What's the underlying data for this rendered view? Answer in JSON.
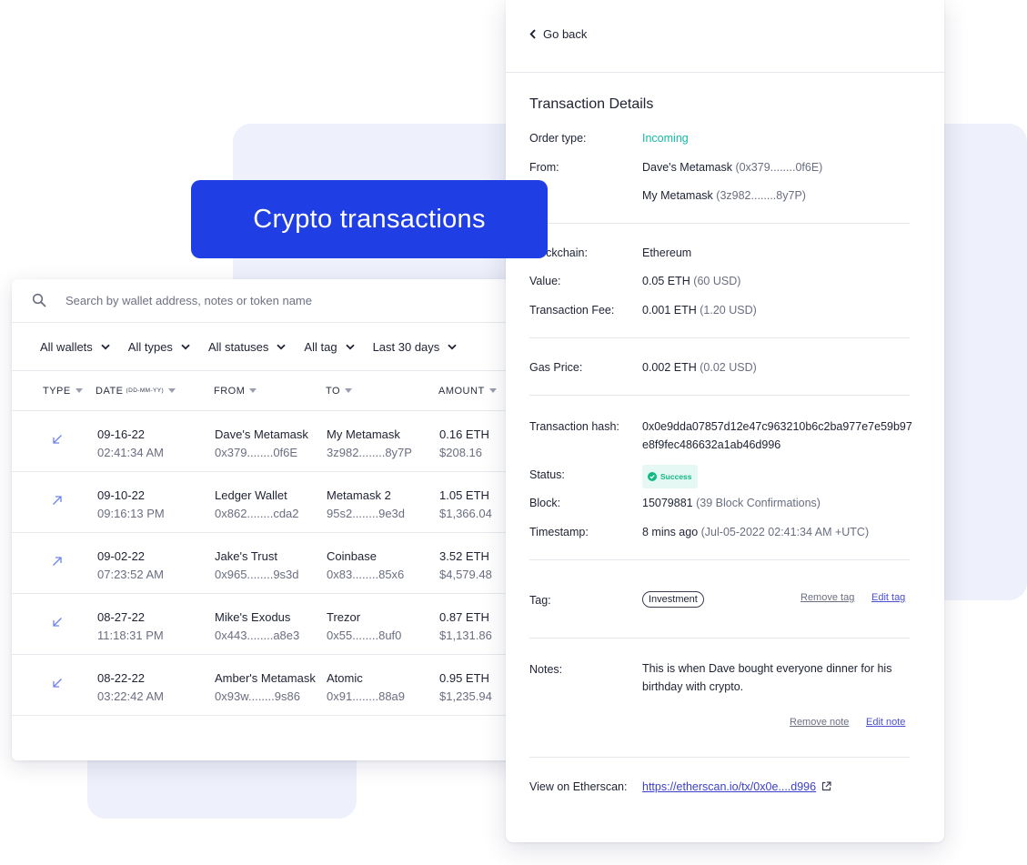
{
  "heading": "Crypto transactions",
  "colors": {
    "accent": "#1f3ee3",
    "incoming": "#17b8a6",
    "success": "#10b981",
    "link": "#3b40c9",
    "arrow": "#6f84ea"
  },
  "list": {
    "search_placeholder": "Search by wallet address, notes or token name",
    "filters": [
      "All wallets",
      "All types",
      "All statuses",
      "All tag",
      "Last 30 days"
    ],
    "headers": {
      "type": "TYPE",
      "date": "DATE",
      "date_format": "(DD-MM-YY)",
      "from": "FROM",
      "to": "TO",
      "amount": "AMOUNT"
    },
    "rows": [
      {
        "direction": "incoming",
        "direction_icon": "arrow-down-left-icon",
        "date": "09-16-22",
        "time": "02:41:34 AM",
        "from_name": "Dave's Metamask",
        "from_addr": "0x379........0f6E",
        "to_name": "My Metamask",
        "to_addr": "3z982........8y7P",
        "amount": "0.16 ETH",
        "usd": "$208.16"
      },
      {
        "direction": "outgoing",
        "direction_icon": "arrow-up-right-icon",
        "date": "09-10-22",
        "time": "09:16:13 PM",
        "from_name": "Ledger Wallet",
        "from_addr": "0x862........cda2",
        "to_name": "Metamask 2",
        "to_addr": "95s2........9e3d",
        "amount": "1.05 ETH",
        "usd": "$1,366.04"
      },
      {
        "direction": "outgoing",
        "direction_icon": "arrow-up-right-icon",
        "date": "09-02-22",
        "time": "07:23:52 AM",
        "from_name": "Jake's Trust",
        "from_addr": "0x965........9s3d",
        "to_name": "Coinbase",
        "to_addr": "0x83........85x6",
        "amount": "3.52 ETH",
        "usd": "$4,579.48"
      },
      {
        "direction": "incoming",
        "direction_icon": "arrow-down-left-icon",
        "date": "08-27-22",
        "time": "11:18:31 PM",
        "from_name": "Mike's Exodus",
        "from_addr": "0x443........a8e3",
        "to_name": "Trezor",
        "to_addr": "0x55........8uf0",
        "amount": "0.87 ETH",
        "usd": "$1,131.86"
      },
      {
        "direction": "incoming",
        "direction_icon": "arrow-down-left-icon",
        "date": "08-22-22",
        "time": "03:22:42 AM",
        "from_name": "Amber's Metamask",
        "from_addr": "0x93w........9s86",
        "to_name": "Atomic",
        "to_addr": "0x91........88a9",
        "amount": "0.95 ETH",
        "usd": "$1,235.94"
      }
    ]
  },
  "details": {
    "back_label": "Go back",
    "title": "Transaction Details",
    "order_type_label": "Order type:",
    "order_type": "Incoming",
    "from_label": "From:",
    "from_name": "Dave's Metamask",
    "from_addr": "(0x379........0f6E)",
    "to_name": "My Metamask",
    "to_addr": "(3z982........8y7P)",
    "blockchain_label": "Blockchain:",
    "blockchain": "Ethereum",
    "value_label": "Value:",
    "value": "0.05 ETH",
    "value_usd": "(60 USD)",
    "fee_label": "Transaction Fee:",
    "fee": "0.001 ETH",
    "fee_usd": "(1.20 USD)",
    "gas_label": "Gas Price:",
    "gas": "0.002 ETH",
    "gas_usd": "(0.02 USD)",
    "hash_label": "Transaction hash:",
    "hash": "0x0e9dda07857d12e47c963210b6c2ba977e7e59b97e8f9fec486632a1ab46d996",
    "status_label": "Status:",
    "status": "Success",
    "block_label": "Block:",
    "block": "15079881",
    "block_confirmations": "(39 Block Confirmations)",
    "timestamp_label": "Timestamp:",
    "timestamp": "8 mins ago",
    "timestamp_full": "(Jul-05-2022 02:41:34 AM +UTC)",
    "tag_label": "Tag:",
    "tag": "Investment",
    "remove_tag": "Remove tag",
    "edit_tag": "Edit tag",
    "notes_label": "Notes:",
    "notes": "This is when Dave bought everyone dinner for his birthday with crypto.",
    "remove_note": "Remove note",
    "edit_note": "Edit note",
    "etherscan_label": "View on Etherscan:",
    "etherscan_link": "https://etherscan.io/tx/0x0e....d996"
  }
}
